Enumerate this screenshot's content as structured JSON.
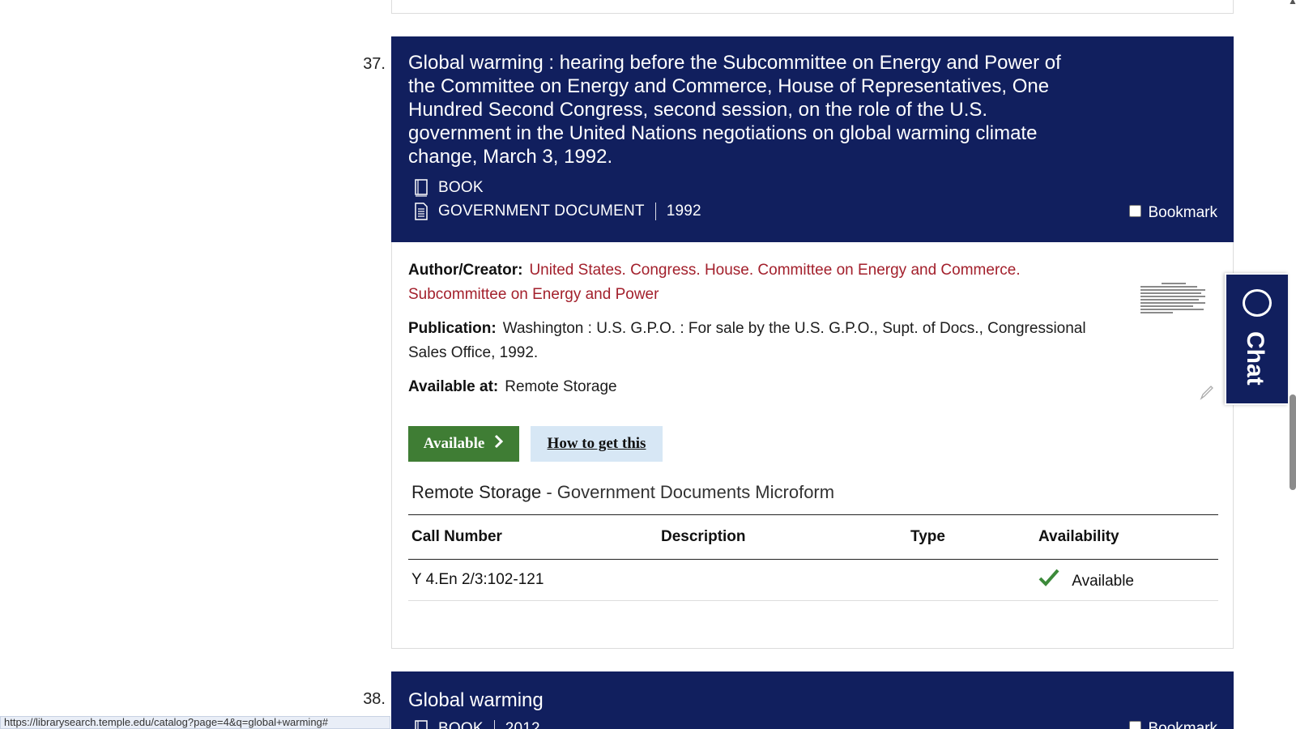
{
  "results": [
    {
      "number": "37.",
      "title": "Global warming : hearing before the Subcommittee on Energy and Power of the Committee on Energy and Commerce, House of Representatives, One Hundred Second Congress, second session, on the role of the U.S. government in the United Nations negotiations on global warming climate change, March 3, 1992.",
      "formats": [
        "BOOK",
        "GOVERNMENT DOCUMENT"
      ],
      "year": "1992",
      "bookmark_label": "Bookmark",
      "author_label": "Author/Creator:",
      "author_value": "United States. Congress. House. Committee on Energy and Commerce. Subcommittee on Energy and Power",
      "publication_label": "Publication:",
      "publication_value": "Washington : U.S. G.P.O. : For sale by the U.S. G.P.O., Supt. of Docs., Congressional Sales Office, 1992.",
      "available_at_label": "Available at:",
      "available_at_value": "Remote Storage",
      "available_button": "Available",
      "how_to_get_button": "How to get this",
      "location_name": "Remote Storage",
      "location_sub": " - Government Documents Microform",
      "holdings": {
        "columns": [
          "Call Number",
          "Description",
          "Type",
          "Availability"
        ],
        "rows": [
          {
            "call_number": "Y 4.En 2/3:102-121",
            "description": "",
            "type": "",
            "availability": "Available"
          }
        ]
      }
    },
    {
      "number": "38.",
      "title": "Global warming",
      "formats": [
        "BOOK"
      ],
      "year": "2012",
      "bookmark_label": "Bookmark"
    }
  ],
  "chat_label": "Chat",
  "status_url": "https://librarysearch.temple.edu/catalog?page=4&q=global+warming#",
  "colors": {
    "header_bg": "#111f5e",
    "author_link": "#a3202c",
    "available_btn": "#3f7d34",
    "howto_btn": "#d7e7f5"
  },
  "icons": [
    "book-icon",
    "document-icon",
    "chevron-right-icon",
    "checkmark-icon",
    "chat-bubble-icon",
    "pencil-icon"
  ]
}
